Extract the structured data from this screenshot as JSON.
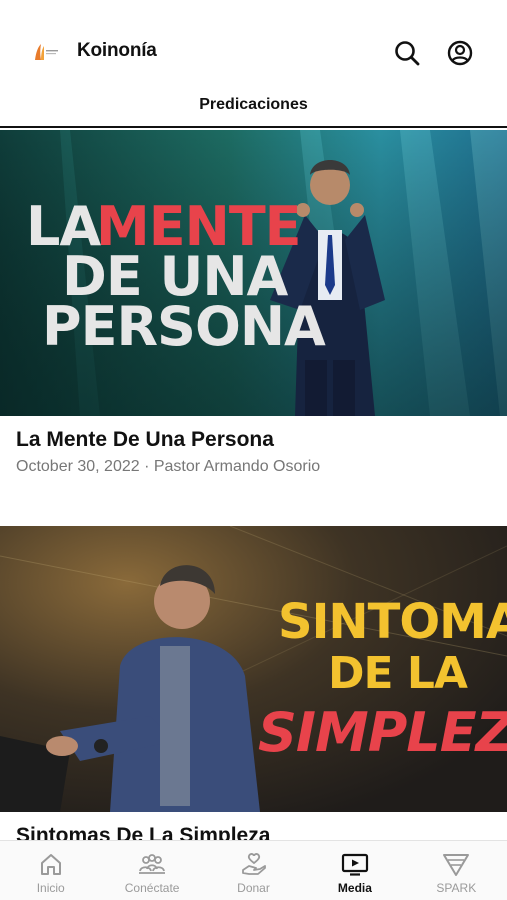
{
  "header": {
    "title": "Koinonía",
    "logo_icon": "church-logo-icon",
    "search_icon": "search-icon",
    "account_icon": "account-circle-icon"
  },
  "subheader": {
    "title": "Predicaciones"
  },
  "sermons": [
    {
      "thumb_lines": [
        "LA MENTE",
        "DE UNA",
        "PERSONA"
      ],
      "thumb_accent_word": "MENTE",
      "title": "La Mente De Una Persona",
      "meta": "October 30, 2022 · Pastor Armando Osorio"
    },
    {
      "thumb_lines": [
        "SINTOMAS",
        "DE LA",
        "SIMPLEZA"
      ],
      "title": "Sintomas De La Simpleza"
    }
  ],
  "tabs": [
    {
      "label": "Inicio",
      "icon": "home-icon",
      "active": false
    },
    {
      "label": "Conéctate",
      "icon": "people-icon",
      "active": false
    },
    {
      "label": "Donar",
      "icon": "donate-hand-heart-icon",
      "active": false
    },
    {
      "label": "Media",
      "icon": "tv-play-icon",
      "active": true
    },
    {
      "label": "SPARK",
      "icon": "spark-triangle-icon",
      "active": false
    }
  ],
  "colors": {
    "accent_red": "#e8434b",
    "accent_yellow": "#f3c22f",
    "text_primary": "#111111",
    "text_secondary": "#777777",
    "tab_inactive": "#9a9a9a"
  }
}
